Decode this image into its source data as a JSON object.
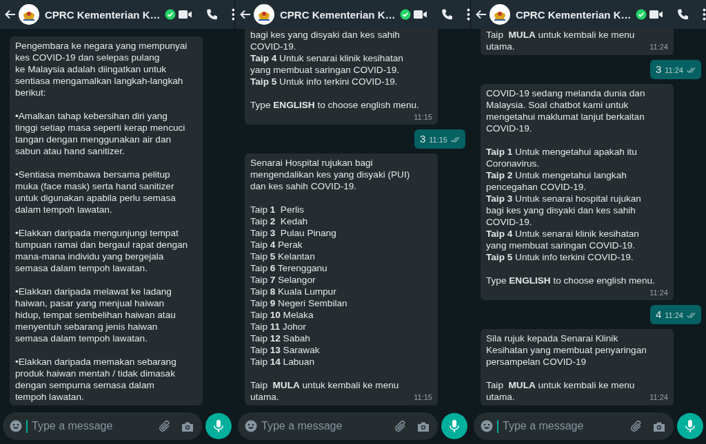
{
  "panels": [
    {
      "header": {
        "title": "CPRC Kementerian K…",
        "verified": true
      },
      "messages": [
        {
          "outgoing": false,
          "text": "Pengembara ke negara yang mempunyai\nkes COVID-19 dan selepas pulang\nke Malaysia adalah diingatkan untuk\nsentiasa mengamalkan langkah-langkah\nberikut:\n\n•Amalkan tahap kebersihan diri yang\ntinggi setiap masa seperti kerap mencuci\ntangan dengan menggunakan air dan\nsabun atau hand sanitizer.\n\n•Sentiasa membawa bersama pelitup\nmuka (face mask) serta hand sanitizer\nuntuk digunakan apabila perlu semasa\ndalam tempoh lawatan.\n\n•Elakkan daripada mengunjungi tempat\ntumpuan ramai dan bergaul rapat dengan\nmana-mana individu yang bergejala\nsemasa dalam tempoh lawatan.\n\n•Elakkan daripada melawat ke ladang\nhaiwan, pasar yang menjual haiwan\nhidup, tempat sembelihan haiwan atau\nmenyentuh sebarang jenis haiwan\nsemasa dalam tempoh lawatan.\n\n•Elakkan daripada memakan sebarang\nproduk haiwan mentah / tidak dimasak\ndengan sempurna semasa dalam\ntempoh lawatan."
        }
      ],
      "composer": {
        "placeholder": "Type a message",
        "focused": true
      }
    },
    {
      "header": {
        "title": "CPRC Kementerian K…",
        "verified": true
      },
      "messages": [
        {
          "outgoing": false,
          "text": "bagi kes yang disyaki dan kes sahih\nCOVID-19.\n**Taip 4** Untuk senarai klinik kesihatan\nyang membuat saringan COVID-19.\n**Taip 5** Untuk info terkini COVID-19.\n\nType **ENGLISH** to choose english menu.",
          "time": "11:15"
        },
        {
          "outgoing": true,
          "text": "3",
          "time": "11:15",
          "read": true
        },
        {
          "outgoing": false,
          "text": "Senarai Hospital rujukan bagi\nmengendalikan kes yang disyaki (PUI)\ndan kes sahih COVID-19.\n\nTaip **1**  Perlis\nTaip **2**  Kedah\nTaip **3**  Pulau Pinang\nTaip **4** Perak\nTaip **5** Kelantan\nTaip **6** Terengganu\nTaip **7** Selangor\nTaip **8** Kuala Lumpur\nTaip **9** Negeri Sembilan\nTaip **10** Melaka\nTaip **11** Johor\nTaip **12** Sabah\nTaip **13** Sarawak\nTaip **14** Labuan\n\nTaip  **MULA** untuk kembali ke menu\nutama.",
          "time": "11:15"
        }
      ],
      "composer": {
        "placeholder": "Type a message",
        "focused": false
      }
    },
    {
      "header": {
        "title": "CPRC Kementerian K…",
        "verified": true
      },
      "messages": [
        {
          "outgoing": false,
          "text": "Taip  **MULA** untuk kembali ke menu\nutama.",
          "time": "11:24"
        },
        {
          "outgoing": true,
          "text": "3",
          "time": "11:24",
          "read": true
        },
        {
          "outgoing": false,
          "text": "COVID-19 sedang melanda dunia dan\nMalaysia. Soal chatbot kami untuk\nmengetahui maklumat lanjut berkaitan\nCOVID-19.\n\n**Taip 1** Untuk mengetahui apakah itu\nCoronavirus.\n**Taip 2** Untuk mengetahui langkah\npencegahan COVID-19.\n**Taip 3** Untuk senarai hospital rujukan\nbagi kes yang disyaki dan kes sahih\nCOVID-19.\n**Taip 4** Untuk senarai klinik kesihatan\nyang membuat saringan COVID-19.\n**Taip 5** Untuk info terkini COVID-19.\n\nType **ENGLISH** to choose english menu.",
          "time": "11:24"
        },
        {
          "outgoing": true,
          "text": "4",
          "time": "11:24",
          "read": true
        },
        {
          "outgoing": false,
          "text": "Sila rujuk kepada Senarai Klinik\nKesihatan yang membuat penyaringan\npersampelan COVID-19\n\nTaip  **MULA** untuk kembali ke menu\nutama.",
          "time": "11:24"
        }
      ],
      "composer": {
        "placeholder": "Type a message",
        "focused": true
      }
    }
  ]
}
